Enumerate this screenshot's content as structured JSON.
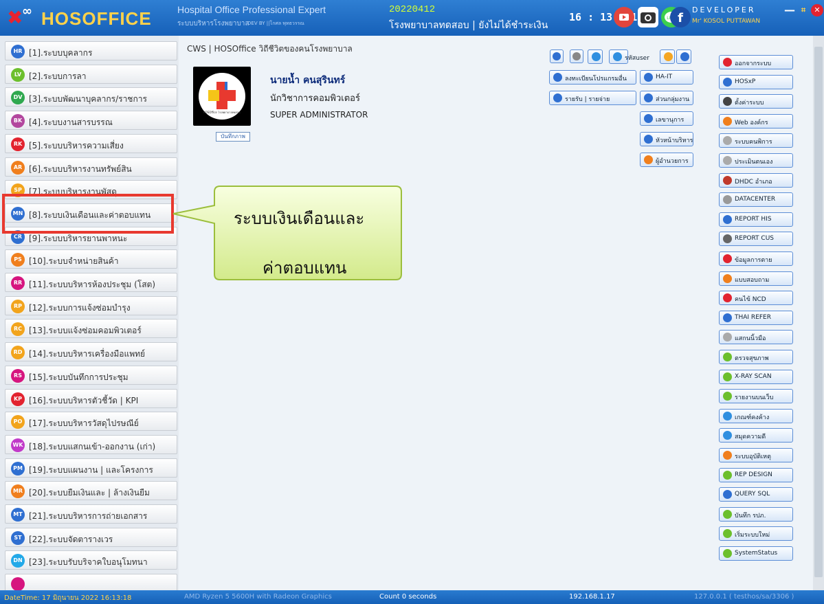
{
  "header": {
    "logo_text": "HOSOFFICE",
    "app_title": "Hospital Office Professional Expert",
    "app_subtitle": "ระบบบริหารโรงพยาบาล",
    "dev_by": "DEV BY ||โกศล พุทธวรรณ",
    "version_date": "20220412",
    "hospital_name": "โรงพยาบาลทดสอบ | ยังไม่ได้ชำระเงิน",
    "clock": "16 : 13 : 18",
    "developer_label": "DEVELOPER",
    "developer_name": "Mr' KOSOL PUTTAWAN",
    "line_icon_text": "LINE"
  },
  "sidebar": {
    "items": [
      {
        "badge": "HR",
        "label": "[1].ระบบบุคลากร",
        "color": "#2f6fd1"
      },
      {
        "badge": "LV",
        "label": "[2].ระบบการลา",
        "color": "#6cbf2c"
      },
      {
        "badge": "DV",
        "label": "[3].ระบบพัฒนาบุคลากร/ราชการ",
        "color": "#2fa84f"
      },
      {
        "badge": "BK",
        "label": "[4].ระบบงานสารบรรณ",
        "color": "#b3479e"
      },
      {
        "badge": "RK",
        "label": "[5].ระบบบริหารความเสี่ยง",
        "color": "#e2232f"
      },
      {
        "badge": "AR",
        "label": "[6].ระบบบริหารงานทรัพย์สิน",
        "color": "#f07f1d"
      },
      {
        "badge": "SP",
        "label": "[7].ระบบบริหารงานพัสดุ",
        "color": "#f2a41c"
      },
      {
        "badge": "MN",
        "label": "[8].ระบบเงินเดือนและค่าตอบแทน",
        "color": "#2f6fd1"
      },
      {
        "badge": "CR",
        "label": "[9].ระบบบริหารยานพาหนะ",
        "color": "#2f6fd1"
      },
      {
        "badge": "PS",
        "label": "[10].ระบบจำหน่ายสินค้า",
        "color": "#f07f1d"
      },
      {
        "badge": "RR",
        "label": "[11].ระบบบริหารห้องประชุม (โสต)",
        "color": "#d6157f"
      },
      {
        "badge": "RP",
        "label": "[12].ระบบการแจ้งซ่อมบำรุง",
        "color": "#f2a41c"
      },
      {
        "badge": "RC",
        "label": "[13].ระบบแจ้งซ่อมคอมพิวเตอร์",
        "color": "#f2a41c"
      },
      {
        "badge": "RD",
        "label": "[14].ระบบบริหารเครื่องมือแพทย์",
        "color": "#f2a41c"
      },
      {
        "badge": "RS",
        "label": "[15].ระบบบันทึกการประชุม",
        "color": "#d6157f"
      },
      {
        "badge": "KP",
        "label": "[16].ระบบบริหารตัวชี้วัด | KPI",
        "color": "#e2232f"
      },
      {
        "badge": "PO",
        "label": "[17].ระบบบริหารวัสดุไปรษณีย์",
        "color": "#f2a41c"
      },
      {
        "badge": "WK",
        "label": "[18].ระบบแสกนเข้า-ออกงาน (เก่า)",
        "color": "#c13ac9"
      },
      {
        "badge": "PM",
        "label": "[19].ระบบแผนงาน | และโครงการ",
        "color": "#2f6fd1"
      },
      {
        "badge": "MR",
        "label": "[20].ระบบยืมเงินและ | ล้างเงินยืม",
        "color": "#f07f1d"
      },
      {
        "badge": "MT",
        "label": "[21].ระบบบริหารการถ่ายเอกสาร",
        "color": "#2f6fd1"
      },
      {
        "badge": "ST",
        "label": "[22].ระบบจัดตารางเวร",
        "color": "#2f6fd1"
      },
      {
        "badge": "DN",
        "label": "[23].ระบบรับบริจาคใบอนุโมทนา",
        "color": "#23a9e8"
      },
      {
        "badge": "",
        "label": "",
        "color": "#d6157f"
      }
    ]
  },
  "main": {
    "breadcrumb": "CWS | HOSOffice วิถีชีวิตของคนโรงพยาบาล",
    "profile": {
      "name": "นายน้ำ   คนสุรินทร์",
      "position": "นักวิชาการคอมพิวเตอร์",
      "role": "SUPER ADMINISTRATOR",
      "photo_button": "บันทึกภาพ",
      "photo_caption": "HOSOffice โรงพยาบาลทดสอบ"
    },
    "small_buttons": [
      {
        "label": "",
        "icon": "transfer-icon",
        "color": "#2f6fd1"
      },
      {
        "label": "",
        "icon": "user-icon",
        "color": "#888888"
      },
      {
        "label": "",
        "icon": "help-icon",
        "color": "#2f6fd1"
      },
      {
        "label": "",
        "icon": "refresh-icon",
        "color": "#2f8fe0"
      }
    ],
    "action_buttons": [
      {
        "label": "รหัสuser",
        "icon": "refresh-icon",
        "color": "#2f8fe0"
      },
      {
        "label": "",
        "icon": "notepad-icon",
        "color": "#f5a623"
      },
      {
        "label": "",
        "icon": "list-icon",
        "color": "#2f6fd1"
      },
      {
        "label": "ลงทะเบียนโปรแกรมอื่น",
        "icon": "upload-icon",
        "color": "#2f6fd1"
      },
      {
        "label": "HA-IT",
        "icon": "upload-icon",
        "color": "#2f6fd1"
      },
      {
        "label": "รายรับ | รายจ่าย",
        "icon": "upload-icon",
        "color": "#2f6fd1"
      },
      {
        "label": "ส่วนกลุ่มงาน",
        "icon": "upload-icon",
        "color": "#2f6fd1"
      },
      {
        "label": "เลขานุการ",
        "icon": "upload-icon",
        "color": "#2f6fd1"
      },
      {
        "label": "หัวหน้าบริหาร",
        "icon": "upload-icon",
        "color": "#2f6fd1"
      },
      {
        "label": "ผู้อำนวยการ",
        "icon": "bolt-icon",
        "color": "#f07f1d"
      }
    ],
    "right_column": [
      {
        "label": "ออกจากระบบ",
        "icon": "close-circle-icon",
        "color": "#e2232f"
      },
      {
        "label": "HOSxP",
        "icon": "hosxp-icon",
        "color": "#2f6fd1"
      },
      {
        "label": "ตั้งค่าระบบ",
        "icon": "gear-icon",
        "color": "#444444"
      },
      {
        "label": "Web องค์กร",
        "icon": "firefox-icon",
        "color": "#f07f1d"
      },
      {
        "label": "ระบบคนพิการ",
        "icon": "wheelchair-icon",
        "color": "#aaaaaa"
      },
      {
        "label": "ประเมินตนเอง",
        "icon": "copyright-icon",
        "color": "#aaaaaa"
      },
      {
        "label": "DHDC อำเภอ",
        "icon": "map-icon",
        "color": "#c0392b"
      },
      {
        "label": "DATACENTER",
        "icon": "database-icon",
        "color": "#999999"
      },
      {
        "label": "REPORT HIS",
        "icon": "report-icon",
        "color": "#2f6fd1"
      },
      {
        "label": "REPORT CUS",
        "icon": "database-icon",
        "color": "#666666"
      },
      {
        "label": "ข้อมูลการตาย",
        "icon": "skull-icon",
        "color": "#e2232f"
      },
      {
        "label": "แบบสอบถาม",
        "icon": "bolt-icon",
        "color": "#f07f1d"
      },
      {
        "label": "คนไข้ NCD",
        "icon": "ncd-icon",
        "color": "#e2232f"
      },
      {
        "label": "THAI REFER",
        "icon": "refer-icon",
        "color": "#2f6fd1"
      },
      {
        "label": "แสกนนิ้วมือ",
        "icon": "document-icon",
        "color": "#aaaaaa"
      },
      {
        "label": "ตรวจสุขภาพ",
        "icon": "document-icon",
        "color": "#6cbf2c"
      },
      {
        "label": "X-RAY SCAN",
        "icon": "document-icon",
        "color": "#6cbf2c"
      },
      {
        "label": "รายงานบนเว็บ",
        "icon": "document-icon",
        "color": "#6cbf2c"
      },
      {
        "label": "เกณฑ์คงค้าง",
        "icon": "lock-icon",
        "color": "#2f8fe0"
      },
      {
        "label": "สมุดความดี",
        "icon": "lock-icon",
        "color": "#2f8fe0"
      },
      {
        "label": "ระบบอุบัติเหตุ",
        "icon": "bolt-icon",
        "color": "#f07f1d"
      },
      {
        "label": "REP DESIGN",
        "icon": "play-icon",
        "color": "#6cbf2c"
      },
      {
        "label": "QUERY SQL",
        "icon": "report-icon",
        "color": "#2f6fd1"
      },
      {
        "label": "บันทึก รปภ.",
        "icon": "play-icon",
        "color": "#6cbf2c"
      },
      {
        "label": "เริ่มระบบใหม่",
        "icon": "play-icon",
        "color": "#6cbf2c"
      },
      {
        "label": "SystemStatus",
        "icon": "play-icon",
        "color": "#6cbf2c"
      }
    ]
  },
  "callout": {
    "line1": "ระบบเงินเดือนและ",
    "line2": "ค่าตอบแทน",
    "highlight_color": "#e8392f"
  },
  "statusbar": {
    "datetime": "DateTime: 17 มิถุนายน 2022 16:13:18",
    "cpu": "AMD Ryzen 5 5600H with Radeon Graphics",
    "count": "Count 0 seconds",
    "ip": "192.168.1.17",
    "db": "127.0.0.1 ( testhos/sa/3306 )"
  }
}
